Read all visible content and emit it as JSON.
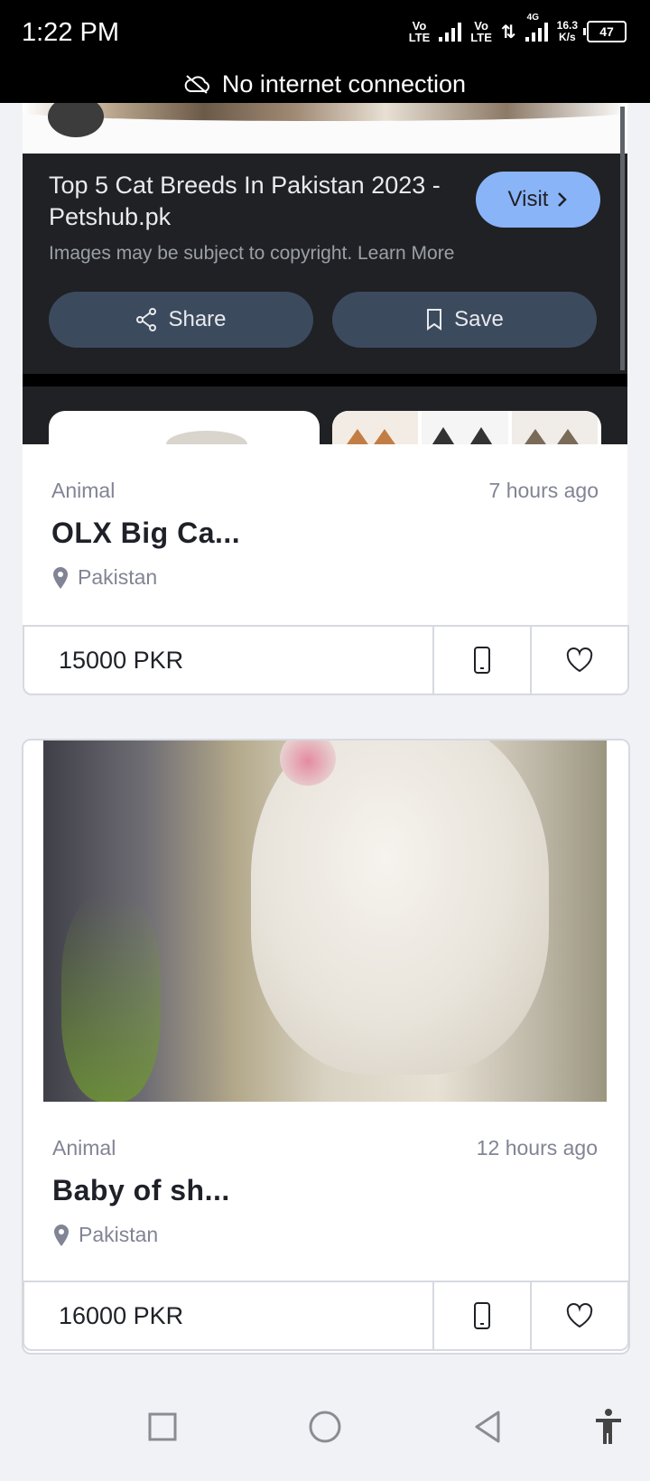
{
  "status_bar": {
    "time": "1:22 PM",
    "sim1_label_top": "Vo",
    "sim1_label_bottom": "LTE",
    "sim2_label_top": "Vo",
    "sim2_label_bottom": "LTE",
    "network_type": "4G",
    "speed_value": "16.3",
    "speed_unit": "K/s",
    "battery_level": "47"
  },
  "connectivity_banner": {
    "text": "No internet connection",
    "icon": "cloud-off-icon"
  },
  "image_viewer": {
    "ad_title": "Top 5 Cat Breeds In Pakistan 2023 - Petshub.pk",
    "visit_label": "Visit",
    "copyright_text": "Images may be subject to copyright. Learn More",
    "share_label": "Share",
    "save_label": "Save",
    "colors": {
      "background": "#202124",
      "visit_button": "#8ab4f8",
      "pill_button": "#3c4a5e"
    }
  },
  "listings": [
    {
      "category": "Animal",
      "time_ago": "7 hours ago",
      "title": "OLX Big Ca...",
      "location": "Pakistan",
      "price": "15000 PKR"
    },
    {
      "category": "Animal",
      "time_ago": "12 hours ago",
      "title": "Baby of sh...",
      "location": "Pakistan",
      "price": "16000 PKR"
    }
  ],
  "nav_bar": {
    "buttons": [
      "recent-apps-icon",
      "home-icon",
      "back-icon",
      "accessibility-icon"
    ]
  }
}
